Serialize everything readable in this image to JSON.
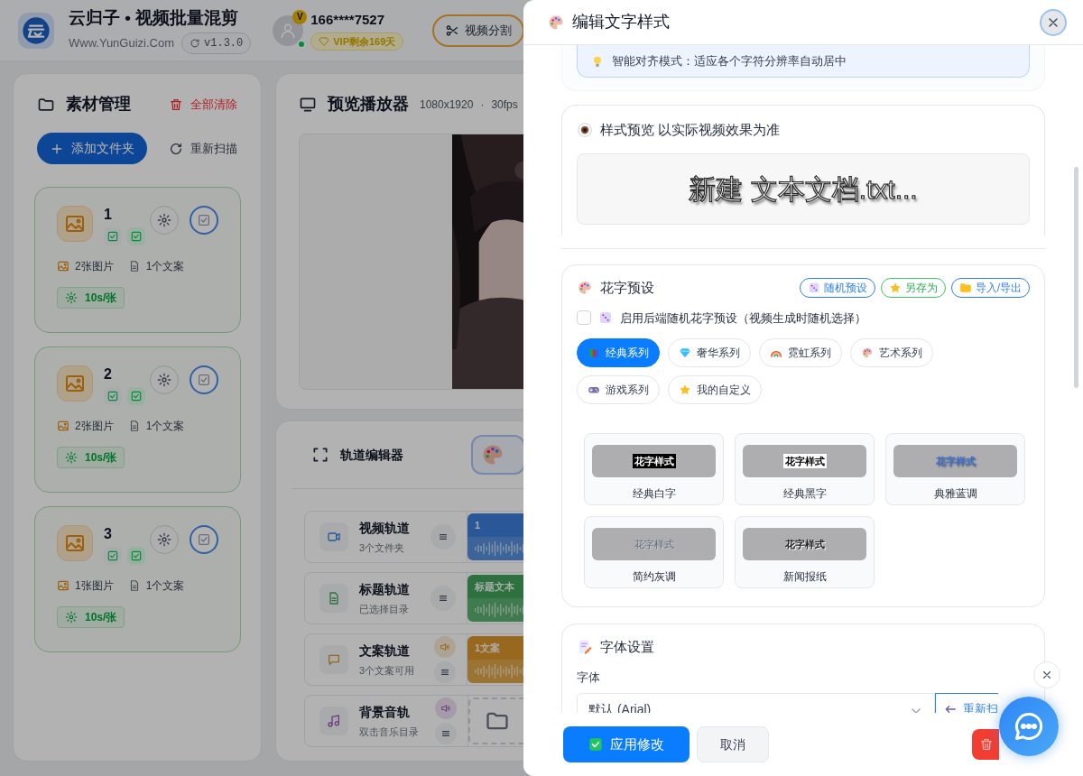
{
  "app": {
    "title": "云归子 • 视频批量混剪",
    "website": "Www.YunGuizi.Com",
    "version": "v1.3.0"
  },
  "user": {
    "phone": "166****7527",
    "badge": "V",
    "vip": "VIP剩余169天",
    "online": true
  },
  "toolbar": [
    {
      "label": "视频分割"
    }
  ],
  "material_panel": {
    "title": "素材管理",
    "clear": "全部清除",
    "add": "添加文件夹",
    "rescan": "重新扫描",
    "folders": [
      {
        "name": "1",
        "images": "2张图片",
        "texts": "1个文案",
        "duration": "10s/张",
        "toggles": [
          {
            "checked": true
          },
          {
            "checked": true
          }
        ]
      },
      {
        "name": "2",
        "images": "2张图片",
        "texts": "1个文案",
        "duration": "10s/张",
        "toggles": [
          {
            "checked": true
          },
          {
            "checked": true
          }
        ]
      },
      {
        "name": "3",
        "images": "1张图片",
        "texts": "1个文案",
        "duration": "10s/张",
        "toggles": [
          {
            "checked": true
          },
          {
            "checked": true
          }
        ]
      }
    ]
  },
  "preview": {
    "title": "预览播放器",
    "resolution": "1080x1920",
    "separator": "·",
    "fps": "30fps"
  },
  "tracks_panel": {
    "title": "轨道编辑器",
    "tracks": [
      {
        "kind": "video",
        "name": "视频轨道",
        "subtitle": "3个文件夹",
        "clip": "1",
        "sound": false
      },
      {
        "kind": "title",
        "name": "标题轨道",
        "subtitle": "已选择目录",
        "clip": "标题文本",
        "sound": false
      },
      {
        "kind": "copy",
        "name": "文案轨道",
        "subtitle": "3个文案可用",
        "clip": "1文案",
        "sound": true
      },
      {
        "kind": "music",
        "name": "背景音轨",
        "subtitle": "双击音乐目录",
        "sound": true
      }
    ]
  },
  "dialog": {
    "title": "编辑文字样式",
    "tip": "智能对齐模式：适应各个字符分辨率自动居中",
    "preview": {
      "title": "样式预览 以实际视频效果为准",
      "sample": "新建 文本文档.txt..."
    },
    "presets": {
      "title": "花字预设",
      "actions": [
        {
          "label": "随机预设",
          "kind": "random"
        },
        {
          "label": "另存为",
          "kind": "save"
        },
        {
          "label": "导入/导出",
          "kind": "import"
        }
      ],
      "random_backend": {
        "label": "启用后端随机花字预设（视频生成时随机选择）",
        "checked": false
      },
      "categories": [
        {
          "label": "经典系列",
          "kind": "books",
          "selected": true
        },
        {
          "label": "奢华系列",
          "kind": "diamond",
          "selected": false
        },
        {
          "label": "霓虹系列",
          "kind": "rainbow",
          "selected": false
        },
        {
          "label": "艺术系列",
          "kind": "palette",
          "selected": false
        },
        {
          "label": "游戏系列",
          "kind": "gamepad",
          "selected": false
        },
        {
          "label": "我的自定义",
          "kind": "star",
          "selected": false
        }
      ],
      "styles": [
        {
          "sample": "花字样式",
          "name": "经典白字",
          "kind": "white"
        },
        {
          "sample": "花字样式",
          "name": "经典黑字",
          "kind": "black"
        },
        {
          "sample": "花字样式",
          "name": "典雅蓝调",
          "kind": "blue"
        },
        {
          "sample": "花字样式",
          "name": "简约灰调",
          "kind": "gray"
        },
        {
          "sample": "花字样式",
          "name": "新闻报纸",
          "kind": "news"
        }
      ]
    },
    "font": {
      "title": "字体设置",
      "label": "字体",
      "value": "默认 (Arial)",
      "rescan": "重新扫"
    },
    "buttons": {
      "apply": "应用修改",
      "cancel": "取消"
    }
  }
}
